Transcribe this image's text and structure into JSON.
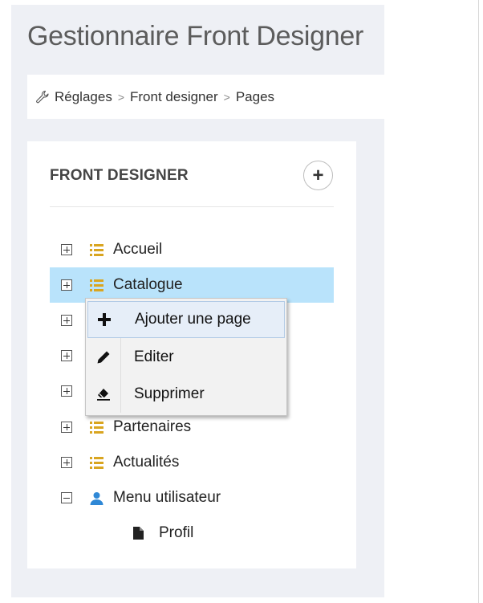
{
  "page": {
    "title": "Gestionnaire Front Designer"
  },
  "breadcrumb": {
    "icon": "wrench-icon",
    "items": [
      "Réglages",
      "Front designer",
      "Pages"
    ],
    "separator": ">"
  },
  "tree": {
    "header": "FRONT DESIGNER",
    "add_icon": "plus-icon",
    "nodes": [
      {
        "label": "Accueil",
        "icon": "list-icon",
        "expander": "+",
        "selected": false
      },
      {
        "label": "Catalogue",
        "icon": "list-icon",
        "expander": "+",
        "selected": true
      },
      {
        "label": "",
        "icon": "list-icon",
        "expander": "+",
        "selected": false
      },
      {
        "label": "",
        "icon": "list-icon",
        "expander": "+",
        "selected": false
      },
      {
        "label": "",
        "icon": "list-icon",
        "expander": "+",
        "selected": false
      },
      {
        "label": "Partenaires",
        "icon": "list-icon",
        "expander": "+",
        "selected": false
      },
      {
        "label": "Actualités",
        "icon": "list-icon",
        "expander": "+",
        "selected": false
      },
      {
        "label": "Menu utilisateur",
        "icon": "user-icon",
        "expander": "−",
        "selected": false
      },
      {
        "label": "Profil",
        "icon": "file-icon",
        "expander": "",
        "selected": false
      }
    ]
  },
  "context_menu": {
    "items": [
      {
        "label": "Ajouter une page",
        "icon": "plus-icon"
      },
      {
        "label": "Editer",
        "icon": "pencil-icon"
      },
      {
        "label": "Supprimer",
        "icon": "eraser-icon"
      }
    ]
  },
  "colors": {
    "selected_row": "#b9e3fb",
    "list_icon": "#d9a520",
    "user_icon": "#2f88d6"
  }
}
